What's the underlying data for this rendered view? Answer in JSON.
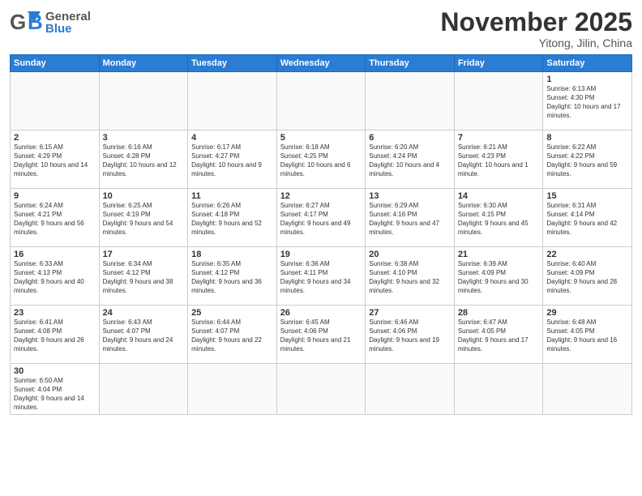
{
  "header": {
    "logo": {
      "general": "General",
      "blue": "Blue"
    },
    "title": "November 2025",
    "subtitle": "Yitong, Jilin, China"
  },
  "days_of_week": [
    "Sunday",
    "Monday",
    "Tuesday",
    "Wednesday",
    "Thursday",
    "Friday",
    "Saturday"
  ],
  "weeks": [
    [
      {
        "day": "",
        "info": ""
      },
      {
        "day": "",
        "info": ""
      },
      {
        "day": "",
        "info": ""
      },
      {
        "day": "",
        "info": ""
      },
      {
        "day": "",
        "info": ""
      },
      {
        "day": "",
        "info": ""
      },
      {
        "day": "1",
        "info": "Sunrise: 6:13 AM\nSunset: 4:30 PM\nDaylight: 10 hours and 17 minutes."
      }
    ],
    [
      {
        "day": "2",
        "info": "Sunrise: 6:15 AM\nSunset: 4:29 PM\nDaylight: 10 hours and 14 minutes."
      },
      {
        "day": "3",
        "info": "Sunrise: 6:16 AM\nSunset: 4:28 PM\nDaylight: 10 hours and 12 minutes."
      },
      {
        "day": "4",
        "info": "Sunrise: 6:17 AM\nSunset: 4:27 PM\nDaylight: 10 hours and 9 minutes."
      },
      {
        "day": "5",
        "info": "Sunrise: 6:18 AM\nSunset: 4:25 PM\nDaylight: 10 hours and 6 minutes."
      },
      {
        "day": "6",
        "info": "Sunrise: 6:20 AM\nSunset: 4:24 PM\nDaylight: 10 hours and 4 minutes."
      },
      {
        "day": "7",
        "info": "Sunrise: 6:21 AM\nSunset: 4:23 PM\nDaylight: 10 hours and 1 minute."
      },
      {
        "day": "8",
        "info": "Sunrise: 6:22 AM\nSunset: 4:22 PM\nDaylight: 9 hours and 59 minutes."
      }
    ],
    [
      {
        "day": "9",
        "info": "Sunrise: 6:24 AM\nSunset: 4:21 PM\nDaylight: 9 hours and 56 minutes."
      },
      {
        "day": "10",
        "info": "Sunrise: 6:25 AM\nSunset: 4:19 PM\nDaylight: 9 hours and 54 minutes."
      },
      {
        "day": "11",
        "info": "Sunrise: 6:26 AM\nSunset: 4:18 PM\nDaylight: 9 hours and 52 minutes."
      },
      {
        "day": "12",
        "info": "Sunrise: 6:27 AM\nSunset: 4:17 PM\nDaylight: 9 hours and 49 minutes."
      },
      {
        "day": "13",
        "info": "Sunrise: 6:29 AM\nSunset: 4:16 PM\nDaylight: 9 hours and 47 minutes."
      },
      {
        "day": "14",
        "info": "Sunrise: 6:30 AM\nSunset: 4:15 PM\nDaylight: 9 hours and 45 minutes."
      },
      {
        "day": "15",
        "info": "Sunrise: 6:31 AM\nSunset: 4:14 PM\nDaylight: 9 hours and 42 minutes."
      }
    ],
    [
      {
        "day": "16",
        "info": "Sunrise: 6:33 AM\nSunset: 4:13 PM\nDaylight: 9 hours and 40 minutes."
      },
      {
        "day": "17",
        "info": "Sunrise: 6:34 AM\nSunset: 4:12 PM\nDaylight: 9 hours and 38 minutes."
      },
      {
        "day": "18",
        "info": "Sunrise: 6:35 AM\nSunset: 4:12 PM\nDaylight: 9 hours and 36 minutes."
      },
      {
        "day": "19",
        "info": "Sunrise: 6:36 AM\nSunset: 4:11 PM\nDaylight: 9 hours and 34 minutes."
      },
      {
        "day": "20",
        "info": "Sunrise: 6:38 AM\nSunset: 4:10 PM\nDaylight: 9 hours and 32 minutes."
      },
      {
        "day": "21",
        "info": "Sunrise: 6:39 AM\nSunset: 4:09 PM\nDaylight: 9 hours and 30 minutes."
      },
      {
        "day": "22",
        "info": "Sunrise: 6:40 AM\nSunset: 4:09 PM\nDaylight: 9 hours and 28 minutes."
      }
    ],
    [
      {
        "day": "23",
        "info": "Sunrise: 6:41 AM\nSunset: 4:08 PM\nDaylight: 9 hours and 26 minutes."
      },
      {
        "day": "24",
        "info": "Sunrise: 6:43 AM\nSunset: 4:07 PM\nDaylight: 9 hours and 24 minutes."
      },
      {
        "day": "25",
        "info": "Sunrise: 6:44 AM\nSunset: 4:07 PM\nDaylight: 9 hours and 22 minutes."
      },
      {
        "day": "26",
        "info": "Sunrise: 6:45 AM\nSunset: 4:06 PM\nDaylight: 9 hours and 21 minutes."
      },
      {
        "day": "27",
        "info": "Sunrise: 6:46 AM\nSunset: 4:06 PM\nDaylight: 9 hours and 19 minutes."
      },
      {
        "day": "28",
        "info": "Sunrise: 6:47 AM\nSunset: 4:05 PM\nDaylight: 9 hours and 17 minutes."
      },
      {
        "day": "29",
        "info": "Sunrise: 6:48 AM\nSunset: 4:05 PM\nDaylight: 9 hours and 16 minutes."
      }
    ],
    [
      {
        "day": "30",
        "info": "Sunrise: 6:50 AM\nSunset: 4:04 PM\nDaylight: 9 hours and 14 minutes."
      },
      {
        "day": "",
        "info": ""
      },
      {
        "day": "",
        "info": ""
      },
      {
        "day": "",
        "info": ""
      },
      {
        "day": "",
        "info": ""
      },
      {
        "day": "",
        "info": ""
      },
      {
        "day": "",
        "info": ""
      }
    ]
  ]
}
